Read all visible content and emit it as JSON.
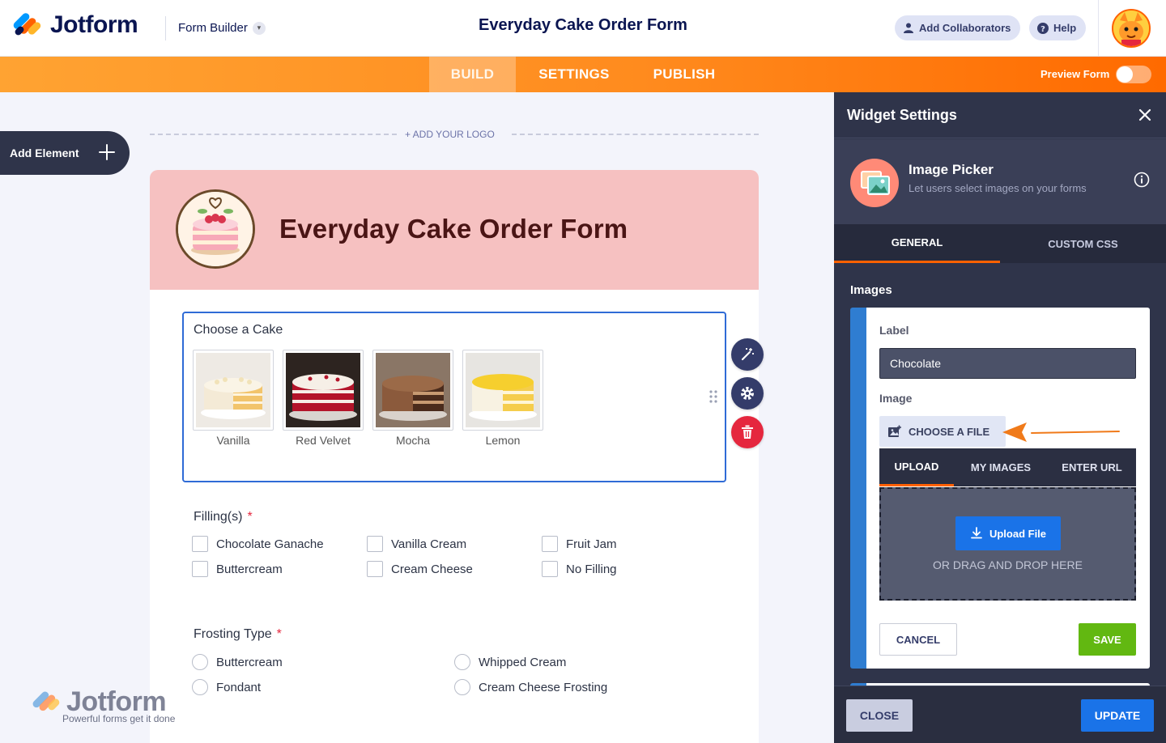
{
  "app": {
    "logo_text": "Jotform",
    "mode_label": "Form Builder",
    "page_title": "Everyday Cake Order Form"
  },
  "header": {
    "add_collaborators": "Add Collaborators",
    "help": "Help"
  },
  "nav": {
    "tabs": [
      "BUILD",
      "SETTINGS",
      "PUBLISH"
    ],
    "active": "BUILD",
    "preview_label": "Preview Form",
    "preview_on": false
  },
  "builder": {
    "add_element": "Add Element",
    "add_logo": "+ ADD YOUR LOGO"
  },
  "form": {
    "title": "Everyday Cake Order Form",
    "picker": {
      "label": "Choose a Cake",
      "options": [
        "Vanilla",
        "Red Velvet",
        "Mocha",
        "Lemon"
      ]
    },
    "fillings": {
      "label": "Filling(s)",
      "required_mark": "*",
      "options": [
        "Chocolate Ganache",
        "Vanilla Cream",
        "Fruit Jam",
        "Buttercream",
        "Cream Cheese",
        "No Filling"
      ]
    },
    "frosting": {
      "label": "Frosting Type",
      "required_mark": "*",
      "options": [
        "Buttercream",
        "Whipped Cream",
        "Fondant",
        "Cream Cheese Frosting"
      ]
    }
  },
  "watermark": {
    "text": "Jotform",
    "tagline": "Powerful forms get it done"
  },
  "panel": {
    "title": "Widget Settings",
    "widget_name": "Image Picker",
    "widget_desc": "Let users select images on your forms",
    "tabs": [
      "GENERAL",
      "CUSTOM CSS"
    ],
    "section_label": "Images",
    "label_field_label": "Label",
    "label_value": "Chocolate",
    "image_field_label": "Image",
    "choose_file": "CHOOSE A FILE",
    "upload_tabs": [
      "UPLOAD",
      "MY IMAGES",
      "ENTER URL"
    ],
    "upload_button": "Upload File",
    "drag_text": "OR DRAG AND DROP HERE",
    "cancel": "CANCEL",
    "save": "SAVE",
    "close": "CLOSE",
    "update": "UPDATE"
  },
  "colors": {
    "brand_orange": "#ff6100",
    "header_pink": "#f6c1c1",
    "accent_blue": "#1a73e8",
    "save_green": "#62b811",
    "panel_dark": "#2f344a"
  }
}
